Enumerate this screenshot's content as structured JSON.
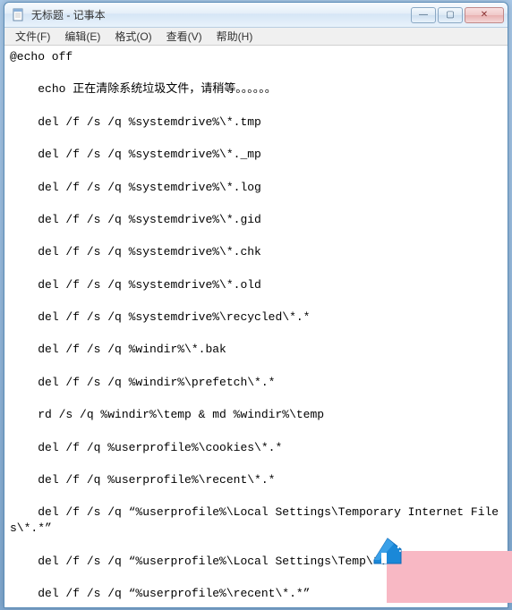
{
  "window": {
    "title": "无标题 - 记事本"
  },
  "menubar": {
    "file": "文件(F)",
    "edit": "编辑(E)",
    "format": "格式(O)",
    "view": "查看(V)",
    "help": "帮助(H)"
  },
  "editor": {
    "content": "@echo off\n\n    echo 正在清除系统垃圾文件，请稍等。。。。。。\n\n    del /f /s /q %systemdrive%\\*.tmp\n\n    del /f /s /q %systemdrive%\\*._mp\n\n    del /f /s /q %systemdrive%\\*.log\n\n    del /f /s /q %systemdrive%\\*.gid\n\n    del /f /s /q %systemdrive%\\*.chk\n\n    del /f /s /q %systemdrive%\\*.old\n\n    del /f /s /q %systemdrive%\\recycled\\*.*\n\n    del /f /s /q %windir%\\*.bak\n\n    del /f /s /q %windir%\\prefetch\\*.*\n\n    rd /s /q %windir%\\temp & md %windir%\\temp\n\n    del /f /q %userprofile%\\cookies\\*.*\n\n    del /f /q %userprofile%\\recent\\*.*\n\n    del /f /s /q “%userprofile%\\Local Settings\\Temporary Internet Files\\*.*”\n\n    del /f /s /q “%userprofile%\\Local Settings\\Temp\\*.*”\n\n    del /f /s /q “%userprofile%\\recent\\*.*”\n\n    echo 系统垃圾清除完毕!\n\n    echo. & pause"
  },
  "icons": {
    "notepad": "notepad-icon",
    "minimize": "—",
    "maximize": "▢",
    "close": "✕"
  }
}
